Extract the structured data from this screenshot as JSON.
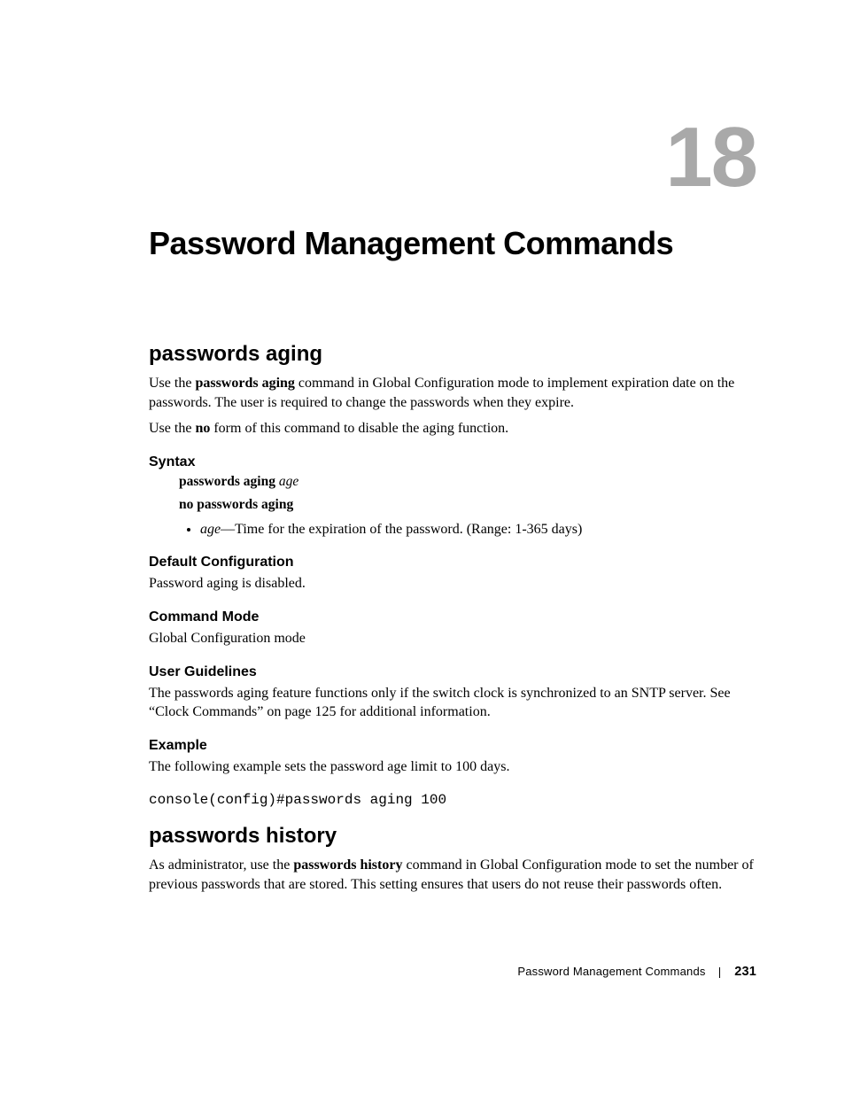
{
  "chapter": {
    "number": "18",
    "title": "Password Management Commands"
  },
  "sections": {
    "aging": {
      "heading": "passwords aging",
      "intro_pre": "Use the ",
      "intro_bold": "passwords aging",
      "intro_post": " command in Global Configuration mode to implement expiration date on the passwords. The user is required to change the passwords when they expire.",
      "noform_pre": "Use the ",
      "noform_bold": "no",
      "noform_post": " form of this command to disable the aging function.",
      "syntax_label": "Syntax",
      "syntax_line1_bold": "passwords aging ",
      "syntax_line1_italic": "age",
      "syntax_line2": "no passwords aging",
      "param_age_name": "age",
      "param_age_desc": "—Time for the expiration of the password. (Range: 1-365 days)",
      "default_label": "Default Configuration",
      "default_text": "Password aging is disabled.",
      "mode_label": "Command Mode",
      "mode_text": "Global Configuration mode",
      "guidelines_label": "User Guidelines",
      "guidelines_text": "The passwords aging feature functions only if the switch clock is synchronized to an SNTP server. See “Clock Commands” on page 125 for additional information.",
      "example_label": "Example",
      "example_text": "The following example sets the password age limit to 100 days.",
      "example_code": "console(config)#passwords aging 100"
    },
    "history": {
      "heading": "passwords history",
      "intro_pre": "As administrator, use the ",
      "intro_bold": "passwords history",
      "intro_post": " command in Global Configuration mode to set the number of previous passwords that are stored. This setting ensures that users do not reuse their passwords often."
    }
  },
  "footer": {
    "title": "Password Management Commands",
    "page": "231"
  }
}
